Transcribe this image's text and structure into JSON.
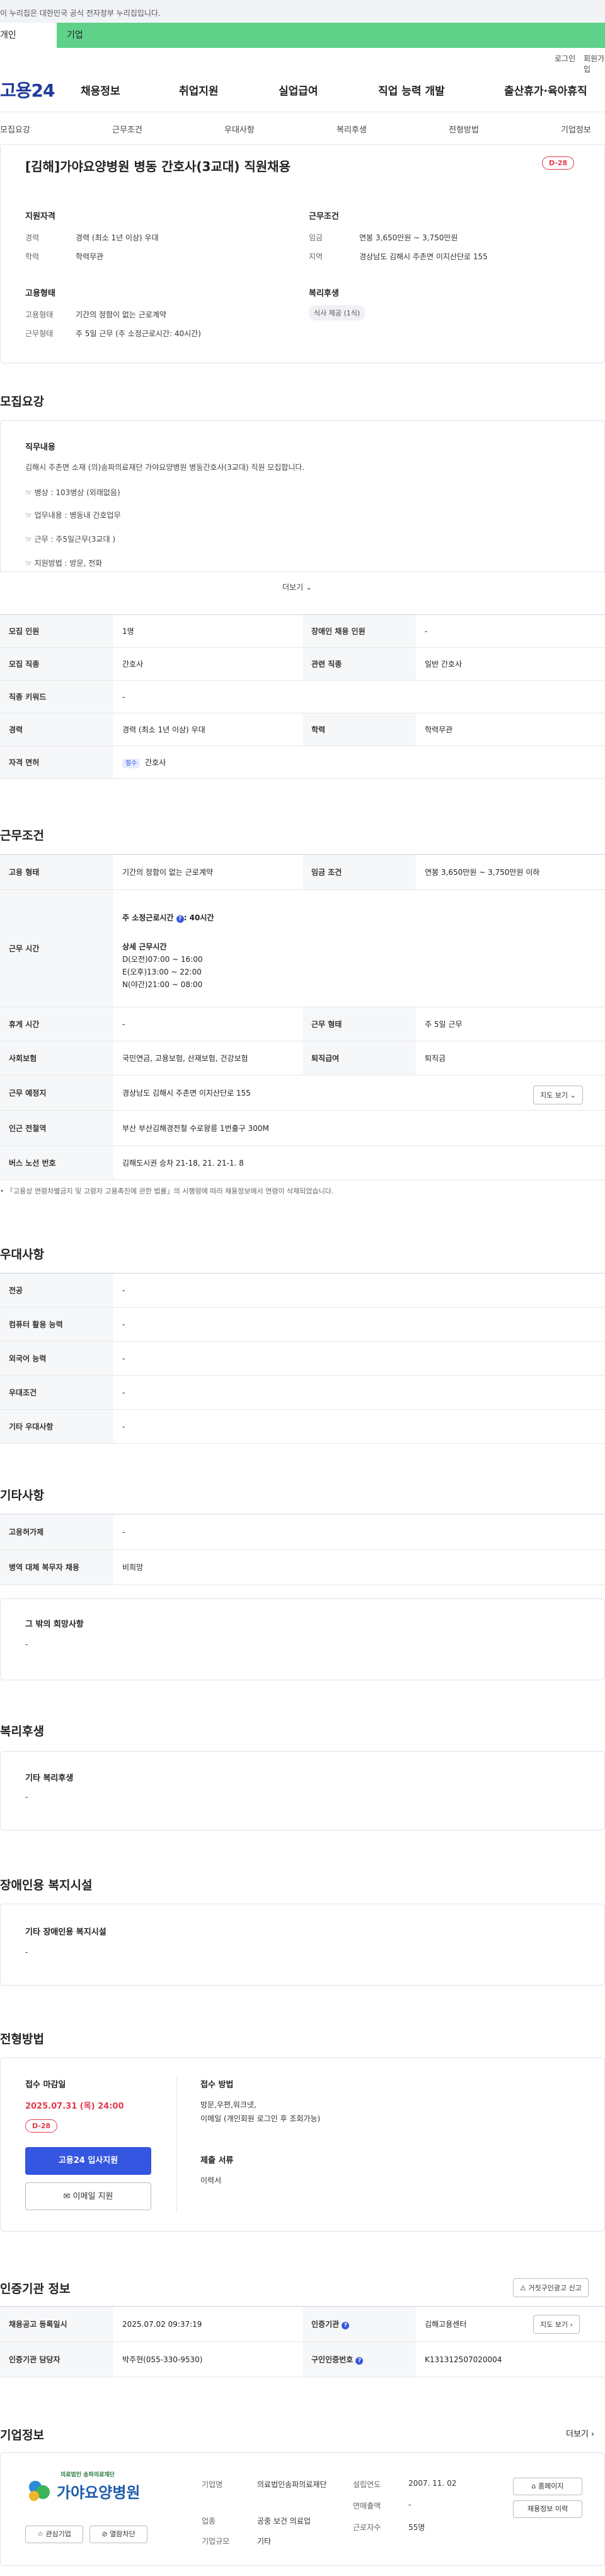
{
  "banner": {
    "text": "이 누리집은 대한민국 공식 전자정부 누리집입니다."
  },
  "user_type": {
    "personal": "개인",
    "business": "기업"
  },
  "util": {
    "login": "로그인",
    "signup": "회원가입"
  },
  "logo": "고용24",
  "gnb": [
    "채용정보",
    "취업지원",
    "실업급여",
    "직업 능력 개발",
    "출산휴가·육아휴직"
  ],
  "subnav": [
    "모집요강",
    "근무조건",
    "우대사항",
    "복리후생",
    "전형방법",
    "기업정보"
  ],
  "summary": {
    "title": "[김해]가야요양병원 병동 간호사(3교대) 직원채용",
    "dday": "D-28",
    "qual_head": "지원자격",
    "qual": [
      {
        "k": "경력",
        "v": "경력 (최소 1년 이상) 우대"
      },
      {
        "k": "학력",
        "v": "학력무관"
      }
    ],
    "cond_head": "근무조건",
    "cond": [
      {
        "k": "임금",
        "v": "연봉 3,650만원 ~ 3,750만원"
      },
      {
        "k": "지역",
        "v": "경상남도 김해시 주촌면 이지산단로 155"
      }
    ],
    "emp_head": "고용형태",
    "emp": [
      {
        "k": "고용형태",
        "v": "기간의 정함이 없는 근로계약"
      },
      {
        "k": "근무형태",
        "v": "주 5일 근무 (주 소정근로시간: 40시간)"
      }
    ],
    "welfare_head": "복리후생",
    "welfare_chip": "식사 제공 (1식)"
  },
  "recruit": {
    "title": "모집요강",
    "duty_head": "직무내용",
    "duty_lines": [
      "김해시 주촌면 소재 (의)송파의료재단 가야요양병원 병동간호사(3교대) 직원 모집합니다.",
      "☞ 병상 : 103병상 (외래없음)",
      "☞ 업무내용 : 병동내 간호업무",
      "☞ 근무 : 주5일근무(3교대 )",
      "☞ 지원방법 : 방문, 전화"
    ],
    "more": "더보기",
    "rows": {
      "headcount_k": "모집 인원",
      "headcount_v": "1명",
      "disabled_k": "장애인 채용 인원",
      "disabled_v": "-",
      "job_k": "모집 직종",
      "job_v": "간호사",
      "rel_job_k": "관련 직종",
      "rel_job_v": "일반 간호사",
      "keyword_k": "직종 키워드",
      "keyword_v": "-",
      "career_k": "경력",
      "career_v": "경력 (최소 1년 이상) 우대",
      "edu_k": "학력",
      "edu_v": "학력무관",
      "license_k": "자격 면허",
      "license_badge": "필수",
      "license_v": "간호사"
    }
  },
  "conditions": {
    "title": "근무조건",
    "emp_k": "고용 형태",
    "emp_v": "기간의 정함이 없는 근로계약",
    "wage_k": "임금 조건",
    "wage_v": "연봉 3,650만원 ~ 3,750만원 이하",
    "hours_k": "근무 시간",
    "hours_weekly": "주 소정근로시간 ",
    "hours_weekly_v": ": 40시간",
    "hours_detail_head": "상세 근무시간",
    "hours_detail": [
      "D(오전)07:00 ~ 16:00",
      "E(오후)13:00 ~ 22:00",
      "N(야간)21:00 ~ 08:00"
    ],
    "rest_k": "휴게 시간",
    "rest_v": "-",
    "worktype_k": "근무 형태",
    "worktype_v": "주 5일 근무",
    "insurance_k": "사회보험",
    "insurance_v": "국민연금, 고용보험, 산재보험, 건강보험",
    "severance_k": "퇴직급여",
    "severance_v": "퇴직금",
    "place_k": "근무 예정지",
    "place_v": "경상남도 김해시 주촌면 이지산단로 155",
    "map_btn": "지도 보기",
    "station_k": "인근 전철역",
    "station_v": "부산 부산김해경전철 수로왕릉 1번출구 300M",
    "bus_k": "버스 노선 번호",
    "bus_v": "김해도시권 승차 21-18, 21. 21-1. 8",
    "note": "「고용상 연령차별금지 및 고령자 고용촉진에 관한 법률」의 시행령에 따라 채용정보에서 연령이 삭제되었습니다."
  },
  "preferred": {
    "title": "우대사항",
    "rows": [
      {
        "k": "전공",
        "v": "-"
      },
      {
        "k": "컴퓨터 활용 능력",
        "v": "-"
      },
      {
        "k": "외국어 능력",
        "v": "-"
      },
      {
        "k": "우대조건",
        "v": "-"
      },
      {
        "k": "기타 우대사항",
        "v": "-"
      }
    ]
  },
  "etc": {
    "title": "기타사항",
    "rows": [
      {
        "k": "고용허가제",
        "v": "-"
      },
      {
        "k": "병역 대체 복무자 채용",
        "v": "비희망"
      }
    ],
    "other_head": "그 밖의 희망사항",
    "other_v": "-"
  },
  "welfare": {
    "title": "복리후생",
    "head": "기타 복리후생",
    "v": "-"
  },
  "disabled_fac": {
    "title": "장애인용 복지시설",
    "head": "기타 장애인용 복지시설",
    "v": "-"
  },
  "process": {
    "title": "전형방법",
    "deadline_head": "접수 마감일",
    "deadline": "2025.07.31 (목) 24:00",
    "dday": "D-28",
    "apply_btn": "고용24 입사지원",
    "email_btn": "이메일 지원",
    "method_head": "접수 방법",
    "method_v1": "방문,우편,워크넷,",
    "method_v2": "이메일 (개인회원 로그인 후 조회가능)",
    "docs_head": "제출 서류",
    "docs_v": "이력서"
  },
  "agency": {
    "title": "인증기관 정보",
    "report_btn": "거짓구인광고 신고",
    "reg_k": "채용공고 등록일시",
    "reg_v": "2025.07.02 09:37:19",
    "agency_k": "인증기관",
    "agency_v": "김해고용센터",
    "map_btn": "지도 보기",
    "manager_k": "인증기관 담당자",
    "manager_v": "박주현(055-330-9530)",
    "jobno_k": "구인인증번호",
    "jobno_v": "K131312507020004"
  },
  "company": {
    "title": "기업정보",
    "more": "더보기",
    "logo_small": "의료법인 송파의료재단",
    "logo_big": "가야요양병원",
    "fav_btn": "관심기업",
    "block_btn": "열람차단",
    "f": [
      {
        "k": "기업명",
        "v": "의료법인송파의료재단"
      },
      {
        "k": "업종",
        "v": "공중 보건 의료업"
      },
      {
        "k": "기업규모",
        "v": "기타"
      }
    ],
    "g": [
      {
        "k": "설립연도",
        "v": "2007. 11. 02"
      },
      {
        "k": "연매출액",
        "v": "-"
      },
      {
        "k": "근로자수",
        "v": "55명"
      }
    ],
    "home_btn": "홈페이지",
    "jobs_btn": "채용정보 이력"
  },
  "colors": {
    "accent": "#3556e0",
    "dday": "#e23b4e",
    "green": "#5fd189"
  }
}
